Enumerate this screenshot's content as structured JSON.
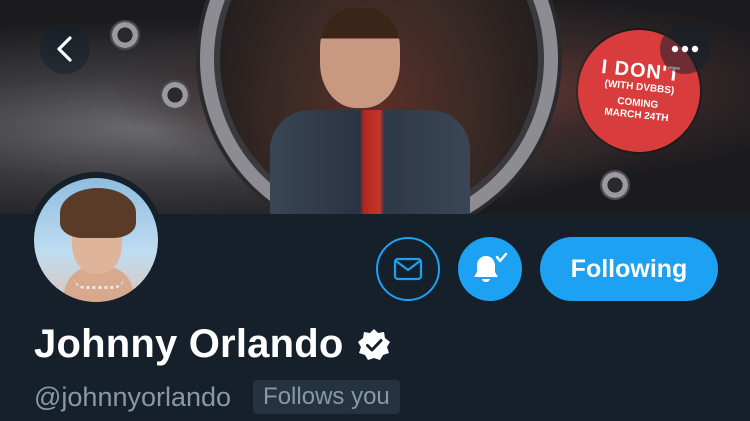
{
  "banner": {
    "sticker": {
      "line1": "I DON'T",
      "line2": "(WITH DVBBS)",
      "line3": "COMING",
      "line4": "MARCH 24TH"
    }
  },
  "nav": {
    "back_icon": "chevron-left-icon",
    "more_icon": "more-horizontal-icon"
  },
  "actions": {
    "message_icon": "envelope-icon",
    "notify_icon": "bell-check-icon",
    "following_label": "Following"
  },
  "profile": {
    "name": "Johnny Orlando",
    "verified": true,
    "handle": "@johnnyorlando",
    "follows_you_label": "Follows you"
  },
  "colors": {
    "background": "#15202b",
    "accent": "#1da1f2",
    "secondary_text": "#8899a6"
  }
}
